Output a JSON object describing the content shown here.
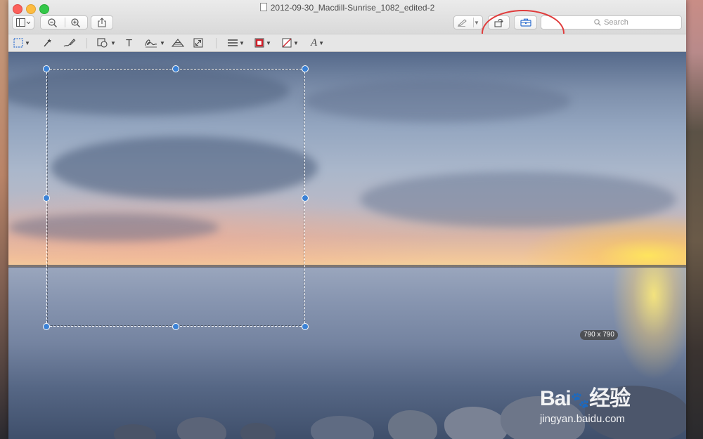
{
  "window": {
    "title": "2012-09-30_Macdill-Sunrise_1082_edited-2"
  },
  "toolbar": {
    "sidebar_button_icon": "sidebar-icon",
    "zoom_out_icon": "zoom-out-icon",
    "zoom_in_icon": "zoom-in-icon",
    "share_icon": "share-icon",
    "pen_icon": "pen-icon",
    "rotate_icon": "rotate-icon",
    "toolbox_icon": "toolbox-icon",
    "search_placeholder": "Search"
  },
  "markup_toolbar": {
    "tools": [
      "rectangular-selection-icon",
      "instant-alpha-icon",
      "sketch-icon",
      "shapes-icon",
      "text-icon",
      "signature-icon",
      "adjust-color-icon",
      "adjust-size-icon",
      "shape-style-icon",
      "border-color-icon",
      "fill-color-icon",
      "text-style-icon"
    ],
    "text_tool_label": "T",
    "text_style_label": "A"
  },
  "image": {
    "selection_size": "790 x 790"
  },
  "watermark": {
    "logo_text": "Bai",
    "logo_text_2": "经验",
    "url": "jingyan.baidu.com"
  },
  "colors": {
    "accent": "#3b82d6",
    "annotation": "#e03c3c",
    "toolbox_icon": "#2f6fd0"
  }
}
